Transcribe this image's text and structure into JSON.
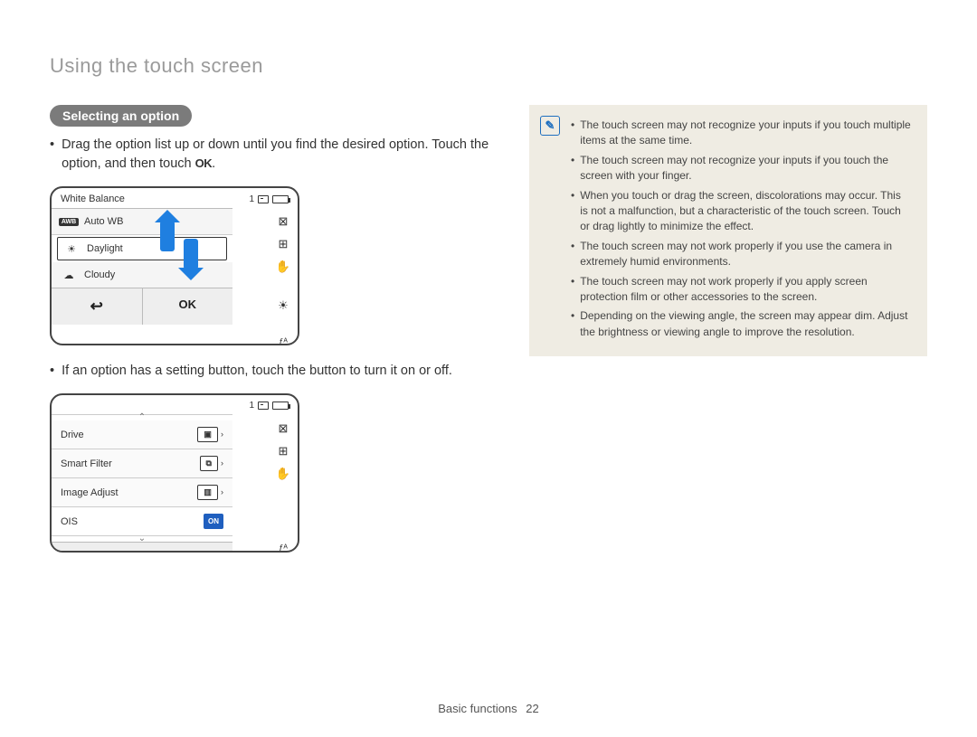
{
  "page_title": "Using the touch screen",
  "section_heading": "Selecting an option",
  "intro_bullet_1a": "Drag the option list up or down until you find the desired option. Touch the option, and then touch ",
  "intro_bullet_1b": ".",
  "ok_glyph": "OK",
  "screen1": {
    "title": "White Balance",
    "count": "1",
    "rows": [
      {
        "icon": "AWB",
        "label": "Auto WB"
      },
      {
        "icon": "sun",
        "label": "Daylight"
      },
      {
        "icon": "cloud",
        "label": "Cloudy"
      }
    ],
    "back_glyph": "↩",
    "ok_label": "OK",
    "side_icons": [
      "⊠",
      "⊞",
      "✋",
      "☀",
      "ƒᴬ"
    ]
  },
  "intro_bullet_2": "If an option has a setting button, touch the button to turn it on or off.",
  "screen2": {
    "count": "1",
    "rows": [
      {
        "label": "Drive",
        "chip": "▣",
        "caret": "›"
      },
      {
        "label": "Smart Filter",
        "chip": "⧉",
        "caret": "›"
      },
      {
        "label": "Image Adjust",
        "chip": "▥",
        "caret": "›"
      },
      {
        "label": "OIS",
        "chip": "ON",
        "on": true
      }
    ],
    "back_glyph": "↩",
    "side_icons": [
      "⊠",
      "⊞",
      "✋",
      "ƒᴬ"
    ]
  },
  "notes": [
    "The touch screen may not recognize your inputs if you touch multiple items at the same time.",
    "The touch screen may not recognize your inputs if you touch the screen with your finger.",
    "When you touch or drag the screen, discolorations may occur. This is not a malfunction, but a characteristic of the touch screen. Touch or drag lightly to minimize the effect.",
    "The touch screen may not work properly if you use the camera in extremely humid environments.",
    "The touch screen may not work properly if you apply screen protection film or other accessories to the screen.",
    "Depending on the viewing angle, the screen may appear dim. Adjust the brightness or viewing angle to improve the resolution."
  ],
  "footer_label": "Basic functions",
  "footer_page": "22"
}
